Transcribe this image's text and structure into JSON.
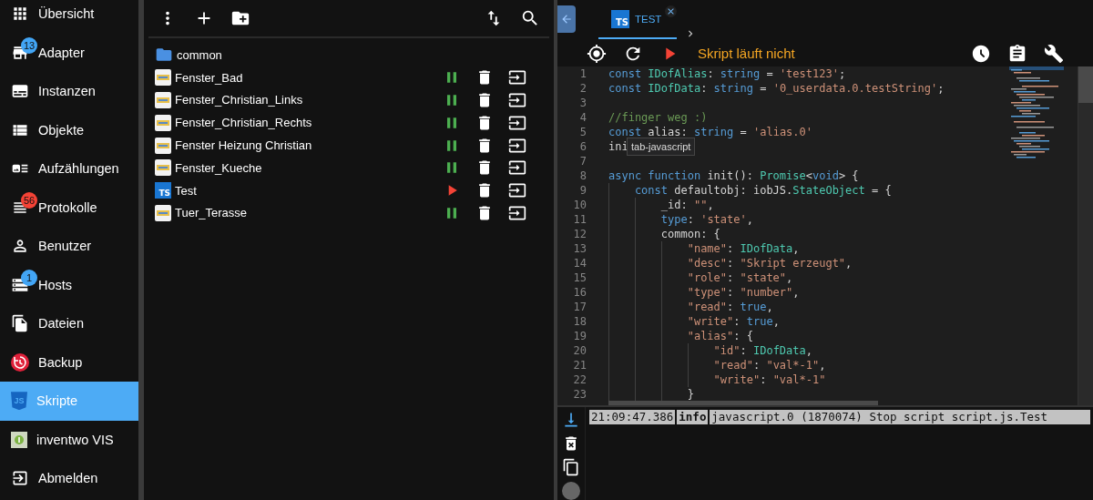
{
  "sidebar": {
    "items": [
      {
        "label": "Übersicht",
        "selected": false
      },
      {
        "label": "Adapter",
        "selected": false,
        "badge": "13",
        "color": "#42a5f5"
      },
      {
        "label": "Instanzen",
        "selected": false
      },
      {
        "label": "Objekte",
        "selected": false
      },
      {
        "label": "Aufzählungen",
        "selected": false
      },
      {
        "label": "Protokolle",
        "selected": false,
        "badge": "56",
        "color": "#f44336"
      },
      {
        "label": "Benutzer",
        "selected": false
      },
      {
        "label": "Hosts",
        "selected": false,
        "badge": "1",
        "color": "#42a5f5"
      },
      {
        "label": "Dateien",
        "selected": false
      },
      {
        "label": "Backup",
        "selected": false
      },
      {
        "label": "Skripte",
        "selected": true,
        "icon_label": "JS"
      },
      {
        "label": "inventwo VIS",
        "selected": false
      },
      {
        "label": "Abmelden",
        "selected": false
      }
    ]
  },
  "scripts": {
    "items": [
      {
        "kind": "folder",
        "name": "common"
      },
      {
        "kind": "blockly",
        "name": "Fenster_Bad",
        "running": true
      },
      {
        "kind": "blockly",
        "name": "Fenster_Christian_Links",
        "running": true
      },
      {
        "kind": "blockly",
        "name": "Fenster_Christian_Rechts",
        "running": true
      },
      {
        "kind": "blockly",
        "name": "Fenster Heizung Christian",
        "running": true
      },
      {
        "kind": "blockly",
        "name": "Fenster_Kueche",
        "running": true
      },
      {
        "kind": "typescript",
        "name": "Test",
        "running": false,
        "icon_label": "TS"
      },
      {
        "kind": "blockly",
        "name": "Tuer_Terasse",
        "running": true
      }
    ]
  },
  "editor": {
    "tabs": [
      {
        "label": "TEST",
        "selected": true,
        "icon_label": "TS"
      }
    ],
    "status": "Skript läuft nicht",
    "running": false,
    "tooltip": "tab-javascript",
    "lines": [
      {
        "number": "1",
        "tokens": [
          {
            "kind": "keyword",
            "text": "const "
          },
          {
            "kind": "type",
            "text": "IDofAlias"
          },
          {
            "kind": "plain",
            "text": ": "
          },
          {
            "kind": "keyword",
            "text": "string"
          },
          {
            "kind": "plain",
            "text": " = "
          },
          {
            "kind": "string",
            "text": "'test123'"
          },
          {
            "kind": "plain",
            "text": ";"
          }
        ]
      },
      {
        "number": "2",
        "tokens": [
          {
            "kind": "keyword",
            "text": "const "
          },
          {
            "kind": "type",
            "text": "IDofData"
          },
          {
            "kind": "plain",
            "text": ": "
          },
          {
            "kind": "keyword",
            "text": "string"
          },
          {
            "kind": "plain",
            "text": " = "
          },
          {
            "kind": "string",
            "text": "'0_userdata.0.testString'"
          },
          {
            "kind": "plain",
            "text": ";"
          }
        ]
      },
      {
        "number": "3"
      },
      {
        "number": "4",
        "tokens": [
          {
            "kind": "comment",
            "text": "//finger weg :)"
          }
        ]
      },
      {
        "number": "5",
        "tokens": [
          {
            "kind": "keyword",
            "text": "const "
          },
          {
            "kind": "plain",
            "text": "alias: "
          },
          {
            "kind": "keyword",
            "text": "string"
          },
          {
            "kind": "plain",
            "text": " = "
          },
          {
            "kind": "string",
            "text": "'alias.0'"
          }
        ]
      },
      {
        "number": "6",
        "tokens": [
          {
            "kind": "plain",
            "text": "ini"
          }
        ]
      },
      {
        "number": "7"
      },
      {
        "number": "8",
        "tokens": [
          {
            "kind": "keyword",
            "text": "async function "
          },
          {
            "kind": "plain",
            "text": "init(): "
          },
          {
            "kind": "type",
            "text": "Promise"
          },
          {
            "kind": "plain",
            "text": "<"
          },
          {
            "kind": "keyword",
            "text": "void"
          },
          {
            "kind": "plain",
            "text": "> {"
          }
        ],
        "children": [
          {
            "number": "9",
            "tokens": [
              {
                "kind": "keyword",
                "text": "const "
              },
              {
                "kind": "plain",
                "text": "defaultobj: iobJS."
              },
              {
                "kind": "type",
                "text": "StateObject"
              },
              {
                "kind": "plain",
                "text": " = {"
              }
            ],
            "children": [
              {
                "number": "10",
                "tokens": [
                  {
                    "kind": "plain",
                    "text": "_id: "
                  },
                  {
                    "kind": "string",
                    "text": "\"\""
                  },
                  {
                    "kind": "plain",
                    "text": ","
                  }
                ]
              },
              {
                "number": "11",
                "tokens": [
                  {
                    "kind": "keyword",
                    "text": "type"
                  },
                  {
                    "kind": "plain",
                    "text": ": "
                  },
                  {
                    "kind": "string",
                    "text": "'state'"
                  },
                  {
                    "kind": "plain",
                    "text": ","
                  }
                ]
              },
              {
                "number": "12",
                "tokens": [
                  {
                    "kind": "plain",
                    "text": "common: {"
                  }
                ],
                "children": [
                  {
                    "number": "13",
                    "tokens": [
                      {
                        "kind": "string",
                        "text": "\"name\""
                      },
                      {
                        "kind": "plain",
                        "text": ": "
                      },
                      {
                        "kind": "type",
                        "text": "IDofData"
                      },
                      {
                        "kind": "plain",
                        "text": ","
                      }
                    ]
                  },
                  {
                    "number": "14",
                    "tokens": [
                      {
                        "kind": "string",
                        "text": "\"desc\""
                      },
                      {
                        "kind": "plain",
                        "text": ": "
                      },
                      {
                        "kind": "string",
                        "text": "\"Skript erzeugt\""
                      },
                      {
                        "kind": "plain",
                        "text": ","
                      }
                    ]
                  },
                  {
                    "number": "15",
                    "tokens": [
                      {
                        "kind": "string",
                        "text": "\"role\""
                      },
                      {
                        "kind": "plain",
                        "text": ": "
                      },
                      {
                        "kind": "string",
                        "text": "\"state\""
                      },
                      {
                        "kind": "plain",
                        "text": ","
                      }
                    ]
                  },
                  {
                    "number": "16",
                    "tokens": [
                      {
                        "kind": "string",
                        "text": "\"type\""
                      },
                      {
                        "kind": "plain",
                        "text": ": "
                      },
                      {
                        "kind": "string",
                        "text": "\"number\""
                      },
                      {
                        "kind": "plain",
                        "text": ","
                      }
                    ]
                  },
                  {
                    "number": "17",
                    "tokens": [
                      {
                        "kind": "string",
                        "text": "\"read\""
                      },
                      {
                        "kind": "plain",
                        "text": ": "
                      },
                      {
                        "kind": "keyword",
                        "text": "true"
                      },
                      {
                        "kind": "plain",
                        "text": ","
                      }
                    ]
                  },
                  {
                    "number": "18",
                    "tokens": [
                      {
                        "kind": "string",
                        "text": "\"write\""
                      },
                      {
                        "kind": "plain",
                        "text": ": "
                      },
                      {
                        "kind": "keyword",
                        "text": "true"
                      },
                      {
                        "kind": "plain",
                        "text": ","
                      }
                    ]
                  },
                  {
                    "number": "19",
                    "tokens": [
                      {
                        "kind": "string",
                        "text": "\"alias\""
                      },
                      {
                        "kind": "plain",
                        "text": ": {"
                      }
                    ],
                    "children": [
                      {
                        "number": "20",
                        "tokens": [
                          {
                            "kind": "string",
                            "text": "\"id\""
                          },
                          {
                            "kind": "plain",
                            "text": ": "
                          },
                          {
                            "kind": "type",
                            "text": "IDofData"
                          },
                          {
                            "kind": "plain",
                            "text": ","
                          }
                        ]
                      },
                      {
                        "number": "21",
                        "tokens": [
                          {
                            "kind": "string",
                            "text": "\"read\""
                          },
                          {
                            "kind": "plain",
                            "text": ": "
                          },
                          {
                            "kind": "string",
                            "text": "\"val*-1\""
                          },
                          {
                            "kind": "plain",
                            "text": ","
                          }
                        ]
                      },
                      {
                        "number": "22",
                        "tokens": [
                          {
                            "kind": "string",
                            "text": "\"write\""
                          },
                          {
                            "kind": "plain",
                            "text": ": "
                          },
                          {
                            "kind": "string",
                            "text": "\"val*-1\""
                          }
                        ]
                      }
                    ]
                  },
                  {
                    "number": "23",
                    "tokens": [
                      {
                        "kind": "plain",
                        "text": "}"
                      }
                    ]
                  }
                ]
              }
            ]
          }
        ]
      }
    ]
  },
  "log": {
    "rows": [
      {
        "time": "21:09:47.386",
        "level": "info",
        "message": "javascript.0 (1870074) Stop script script.js.Test"
      }
    ]
  }
}
